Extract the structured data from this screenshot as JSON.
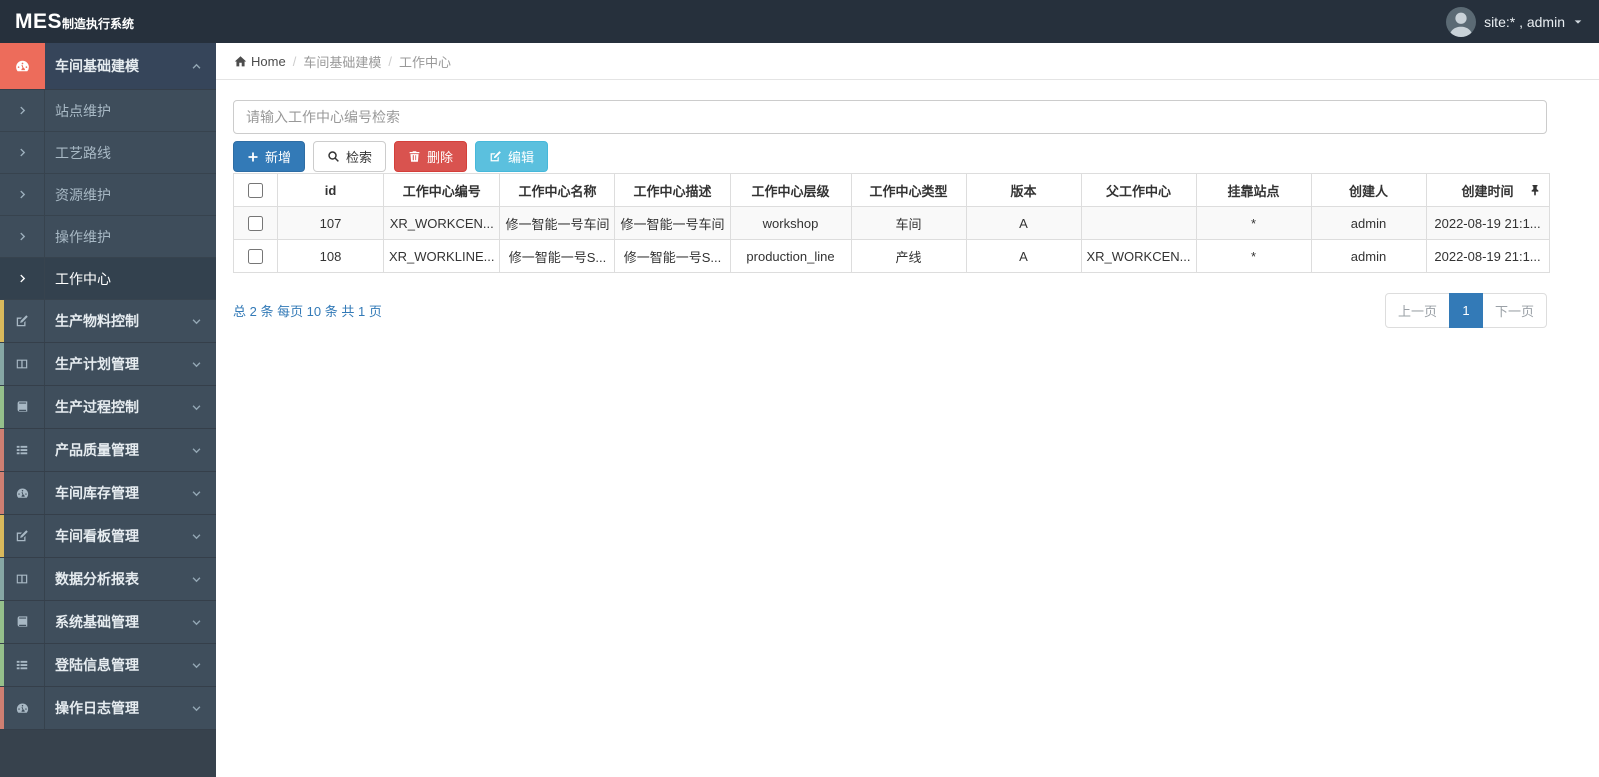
{
  "colors": {
    "primary": "#337ab7",
    "danger": "#d9534f",
    "info": "#5bc0de",
    "accent": "#ed6c5b"
  },
  "app": {
    "brand_bold": "MES",
    "brand_rest": "制造执行系统",
    "user_label": "site:* , admin"
  },
  "breadcrumb": {
    "home": "Home",
    "items": [
      "车间基础建模",
      "工作中心"
    ]
  },
  "sidebar": {
    "active_group": {
      "key": "workshop-basic-modeling",
      "label": "车间基础建模",
      "icon": "dashboard-icon",
      "children": [
        {
          "key": "site-maintenance",
          "label": "站点维护"
        },
        {
          "key": "process-route",
          "label": "工艺路线"
        },
        {
          "key": "resource-maintenance",
          "label": "资源维护"
        },
        {
          "key": "operation-maintenance",
          "label": "操作维护"
        },
        {
          "key": "work-center",
          "label": "工作中心"
        }
      ],
      "active_child": "work-center"
    },
    "groups": [
      {
        "key": "production-material-control",
        "label": "生产物料控制",
        "icon": "edit-icon",
        "strip_color": "#d9b95c"
      },
      {
        "key": "production-plan-management",
        "label": "生产计划管理",
        "icon": "columns-icon",
        "strip_color": "#86a7a4"
      },
      {
        "key": "production-process-control",
        "label": "生产过程控制",
        "icon": "book-icon",
        "strip_color": "#95c08b"
      },
      {
        "key": "product-quality-management",
        "label": "产品质量管理",
        "icon": "list-icon",
        "strip_color": "#cf7f72"
      },
      {
        "key": "workshop-inventory-management",
        "label": "车间库存管理",
        "icon": "dashboard-icon",
        "strip_color": "#cf7f72"
      },
      {
        "key": "workshop-kanban-management",
        "label": "车间看板管理",
        "icon": "edit-icon",
        "strip_color": "#d9b95c"
      },
      {
        "key": "data-analysis-report",
        "label": "数据分析报表",
        "icon": "columns-icon",
        "strip_color": "#86a7a4"
      },
      {
        "key": "system-basic-management",
        "label": "系统基础管理",
        "icon": "book-icon",
        "strip_color": "#95c08b"
      },
      {
        "key": "login-info-management",
        "label": "登陆信息管理",
        "icon": "list-icon",
        "strip_color": "#95c08b"
      },
      {
        "key": "operation-log-management",
        "label": "操作日志管理",
        "icon": "dashboard-icon",
        "strip_color": "#cf7f72"
      }
    ]
  },
  "search": {
    "placeholder": "请输入工作中心编号检索",
    "value": ""
  },
  "toolbar": {
    "add": "新增",
    "search": "检索",
    "delete": "删除",
    "edit": "编辑"
  },
  "table": {
    "columns": [
      "id",
      "工作中心编号",
      "工作中心名称",
      "工作中心描述",
      "工作中心层级",
      "工作中心类型",
      "版本",
      "父工作中心",
      "挂靠站点",
      "创建人",
      "创建时间"
    ],
    "rows": [
      [
        "107",
        "XR_WORKCEN...",
        "修一智能一号车间",
        "修一智能一号车间",
        "workshop",
        "车间",
        "A",
        "",
        "*",
        "admin",
        "2022-08-19 21:1..."
      ],
      [
        "108",
        "XR_WORKLINE...",
        "修一智能一号S...",
        "修一智能一号S...",
        "production_line",
        "产线",
        "A",
        "XR_WORKCEN...",
        "*",
        "admin",
        "2022-08-19 21:1..."
      ]
    ]
  },
  "pagination": {
    "summary": "总 2 条 每页 10 条 共 1 页",
    "prev": "上一页",
    "current": "1",
    "next": "下一页"
  }
}
